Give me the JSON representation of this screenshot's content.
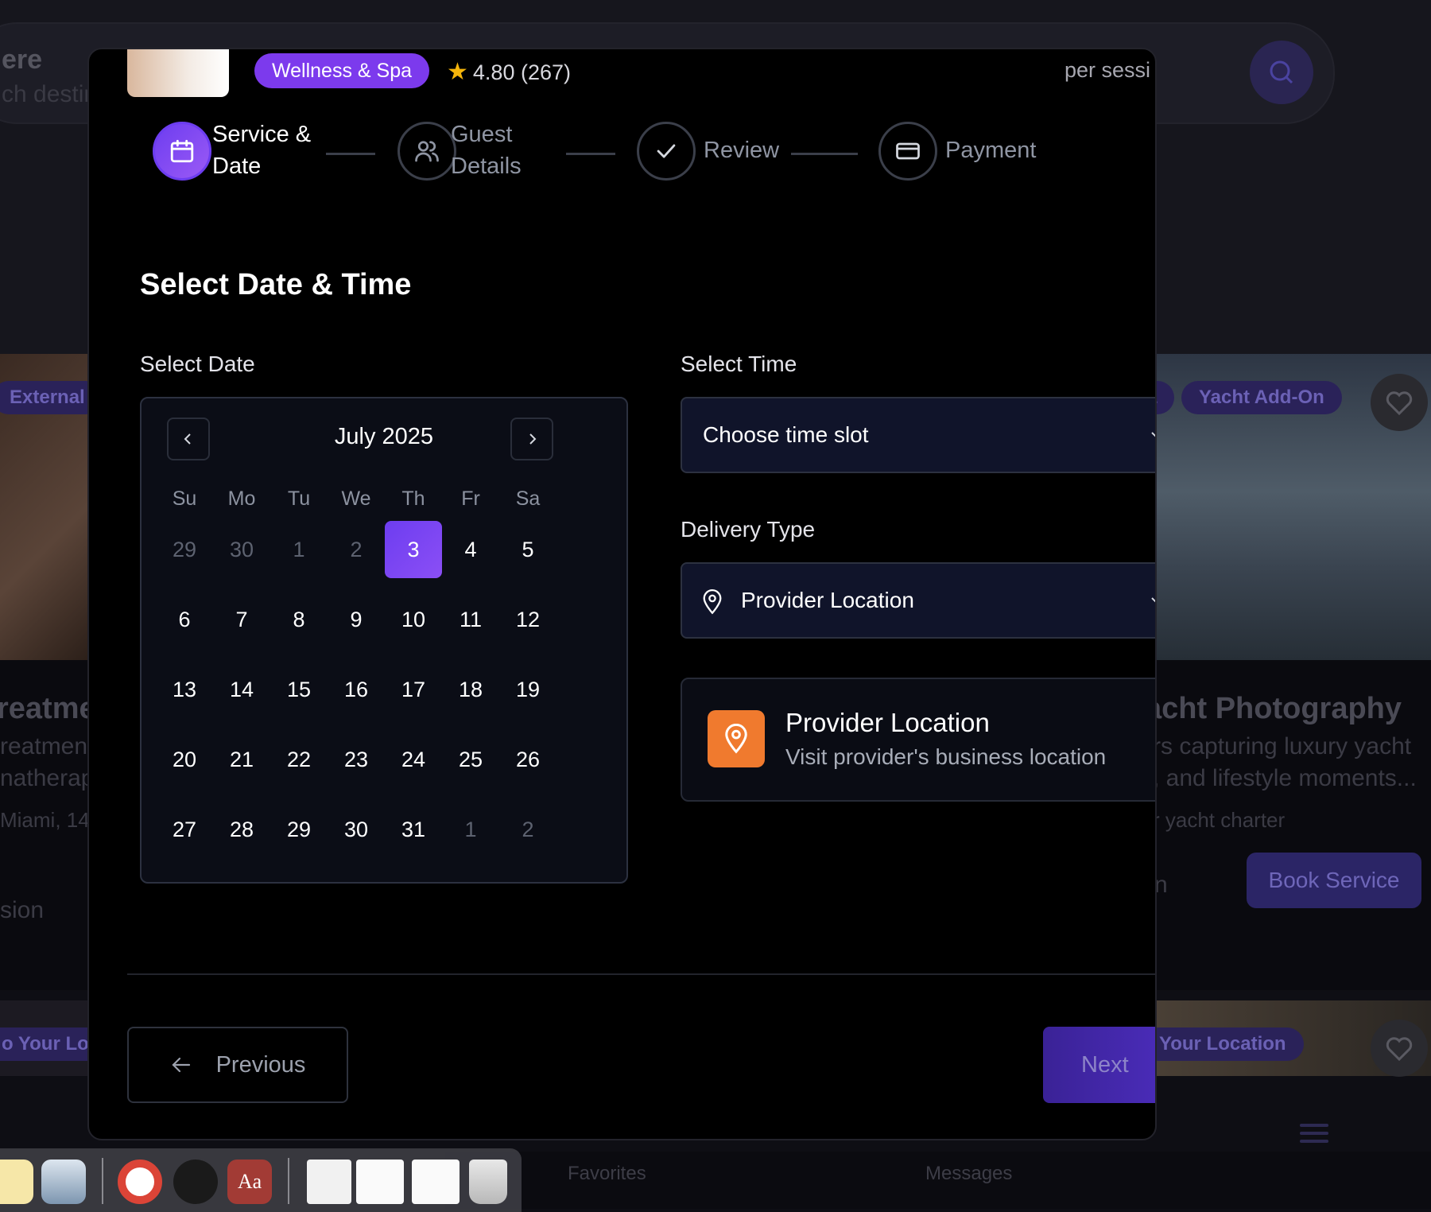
{
  "background": {
    "search_title": "ere",
    "search_sub": "ch destin",
    "per_session_bg": "per session",
    "left_pill": "External",
    "right_pills": [
      "a",
      "Yacht Add-On"
    ],
    "left_card_title": "reatme",
    "left_card_lines": [
      "reatment",
      "natherapy"
    ],
    "left_card_location": "Miami, 14",
    "left_card_extra": "sion",
    "right_card_title": "acht Photography",
    "right_card_lines": [
      "rs capturing luxury yacht",
      ", and lifestyle moments..."
    ],
    "right_card_note": "r yacht charter",
    "right_card_extra": "n",
    "book_button": "Book Service",
    "left_pill2": "o Your Lo",
    "right_pill2": "Your Location",
    "nav_favorites": "Favorites",
    "nav_messages": "Messages"
  },
  "service": {
    "category": "Wellness & Spa",
    "rating": "4.80",
    "reviews": "(267)",
    "price_unit": "per sessi"
  },
  "steps": [
    {
      "line1": "Service &",
      "line2": "Date",
      "icon": "calendar-icon",
      "active": true
    },
    {
      "line1": "Guest",
      "line2": "Details",
      "icon": "users-icon",
      "active": false
    },
    {
      "line1": "Review",
      "line2": "",
      "icon": "check-icon",
      "active": false
    },
    {
      "line1": "Payment",
      "line2": "",
      "icon": "card-icon",
      "active": false
    }
  ],
  "form": {
    "title": "Select Date & Time",
    "date_label": "Select Date",
    "time_label": "Select Time",
    "time_placeholder": "Choose time slot",
    "delivery_label": "Delivery Type",
    "delivery_value": "Provider Location",
    "location_card_title": "Provider Location",
    "location_card_sub": "Visit provider's business location"
  },
  "calendar": {
    "month": "July 2025",
    "weekdays": [
      "Su",
      "Mo",
      "Tu",
      "We",
      "Th",
      "Fr",
      "Sa"
    ],
    "weeks": [
      [
        {
          "d": "29",
          "m": true
        },
        {
          "d": "30",
          "m": true
        },
        {
          "d": "1",
          "m": true
        },
        {
          "d": "2",
          "m": true
        },
        {
          "d": "3",
          "s": true
        },
        {
          "d": "4"
        },
        {
          "d": "5"
        }
      ],
      [
        {
          "d": "6"
        },
        {
          "d": "7"
        },
        {
          "d": "8"
        },
        {
          "d": "9"
        },
        {
          "d": "10"
        },
        {
          "d": "11"
        },
        {
          "d": "12"
        }
      ],
      [
        {
          "d": "13"
        },
        {
          "d": "14"
        },
        {
          "d": "15"
        },
        {
          "d": "16"
        },
        {
          "d": "17"
        },
        {
          "d": "18"
        },
        {
          "d": "19"
        }
      ],
      [
        {
          "d": "20"
        },
        {
          "d": "21"
        },
        {
          "d": "22"
        },
        {
          "d": "23"
        },
        {
          "d": "24"
        },
        {
          "d": "25"
        },
        {
          "d": "26"
        }
      ],
      [
        {
          "d": "27"
        },
        {
          "d": "28"
        },
        {
          "d": "29"
        },
        {
          "d": "30"
        },
        {
          "d": "31"
        },
        {
          "d": "1",
          "m": true
        },
        {
          "d": "2",
          "m": true
        }
      ]
    ],
    "selected_day": "3"
  },
  "actions": {
    "previous": "Previous",
    "next": "Next"
  },
  "colors": {
    "accent": "#7c3aed",
    "location_icon_bg": "#f07a2e"
  }
}
